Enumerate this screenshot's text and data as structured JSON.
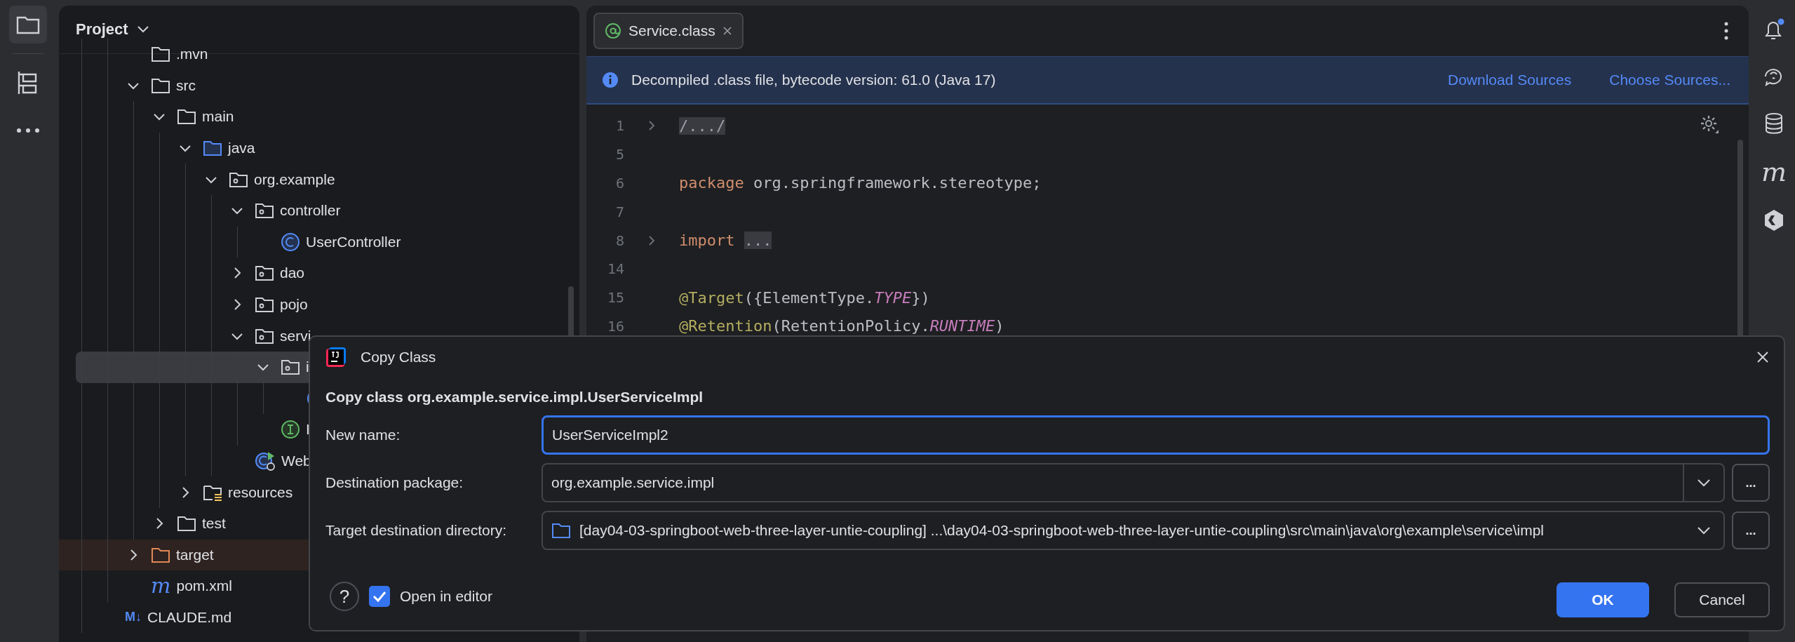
{
  "activity_bar": [
    {
      "kind": "project",
      "selected": true
    },
    {
      "kind": "structure",
      "selected": false
    },
    {
      "kind": "more",
      "selected": false
    }
  ],
  "project_panel": {
    "title": "Project",
    "tree": [
      {
        "children": [
          {
            "label": ".mvn",
            "kind": "folder",
            "selected": false
          },
          {
            "label": "src",
            "kind": "folder",
            "expanded": true,
            "selected": false,
            "children": [
              {
                "label": "main",
                "kind": "folder",
                "expanded": true,
                "selected": false,
                "children": [
                  {
                    "label": "java",
                    "kind": "source-folder",
                    "expanded": true,
                    "selected": false,
                    "children": [
                      {
                        "label": "org.example",
                        "kind": "package",
                        "expanded": true,
                        "selected": false,
                        "children": [
                          {
                            "label": "controller",
                            "kind": "package",
                            "expanded": true,
                            "selected": false,
                            "children": [
                              {
                                "label": "UserController",
                                "kind": "class",
                                "selected": false
                              }
                            ]
                          },
                          {
                            "label": "dao",
                            "kind": "package",
                            "expanded": false,
                            "selected": false
                          },
                          {
                            "label": "pojo",
                            "kind": "package",
                            "expanded": false,
                            "selected": false
                          },
                          {
                            "label": "servi",
                            "kind": "package",
                            "expanded": true,
                            "selected": false,
                            "children": [
                              {
                                "label": "i",
                                "kind": "package",
                                "expanded": true,
                                "selected": true,
                                "children": [
                                  {
                                    "kind": "class",
                                    "selected": false
                                  }
                                ]
                              },
                              {
                                "label": "I",
                                "kind": "interface",
                                "selected": false
                              }
                            ]
                          },
                          {
                            "label": "Web",
                            "kind": "spring-app",
                            "selected": false
                          }
                        ]
                      }
                    ]
                  },
                  {
                    "label": "resources",
                    "kind": "resources-folder",
                    "expanded": false,
                    "selected": false
                  }
                ]
              },
              {
                "label": "test",
                "kind": "folder",
                "expanded": false,
                "selected": false
              }
            ]
          },
          {
            "label": "target",
            "kind": "excluded-folder",
            "expanded": false,
            "selected": false
          },
          {
            "label": "pom.xml",
            "kind": "maven",
            "icon_text": "m",
            "selected": false
          }
        ]
      },
      {
        "label": "CLAUDE.md",
        "kind": "markdown",
        "icon_text": "M↓",
        "selected": false
      }
    ]
  },
  "editor": {
    "tabs": [
      {
        "label": "Service.class",
        "selected": true
      }
    ],
    "banner": {
      "text": "Decompiled .class file, bytecode version: 61.0 (Java 17)",
      "links": [
        "Download Sources",
        "Choose Sources..."
      ]
    },
    "lines": [
      {
        "number": "1",
        "foldable": true,
        "tokens": [
          {
            "kind": "fold",
            "text": "/.../"
          }
        ]
      },
      {
        "number": "5"
      },
      {
        "number": "6",
        "tokens": [
          {
            "kind": "keyword",
            "text": "package "
          },
          {
            "kind": "plain",
            "text": "org.springframework.stereotype;"
          }
        ]
      },
      {
        "number": "7"
      },
      {
        "number": "8",
        "foldable": true,
        "tokens": [
          {
            "kind": "keyword",
            "text": "import "
          },
          {
            "kind": "fold",
            "text": "..."
          }
        ]
      },
      {
        "number": "14"
      },
      {
        "number": "15",
        "tokens": [
          {
            "kind": "annotation",
            "text": "@Target"
          },
          {
            "kind": "plain",
            "text": "({ElementType."
          },
          {
            "kind": "constant",
            "text": "TYPE"
          },
          {
            "kind": "plain",
            "text": "})"
          }
        ]
      },
      {
        "number": "16",
        "tokens": [
          {
            "kind": "annotation",
            "text": "@Retention"
          },
          {
            "kind": "plain",
            "text": "(RetentionPolicy."
          },
          {
            "kind": "constant",
            "text": "RUNTIME"
          },
          {
            "kind": "plain",
            "text": ")"
          }
        ]
      }
    ]
  },
  "right_bar": {
    "maven_glyph": "m"
  },
  "dialog": {
    "title": "Copy Class",
    "heading": "Copy class org.example.service.impl.UserServiceImpl",
    "fields": [
      {
        "label": "New name:",
        "value": "UserServiceImpl2",
        "kind": "text",
        "focused": true
      },
      {
        "label": "Destination package:",
        "value": "org.example.service.impl",
        "kind": "combo",
        "focused": false,
        "browse": "..."
      },
      {
        "label": "Target destination directory:",
        "value": "[day04-03-springboot-web-three-layer-untie-coupling] ...\\day04-03-springboot-web-three-layer-untie-coupling\\src\\main\\java\\org\\example\\service\\impl",
        "kind": "directory",
        "focused": false,
        "browse": "..."
      }
    ],
    "help": "?",
    "checkbox": {
      "label": "Open in editor",
      "checked": true
    },
    "buttons": [
      {
        "label": "OK",
        "kind": "primary"
      },
      {
        "label": "Cancel",
        "kind": "secondary"
      }
    ]
  }
}
